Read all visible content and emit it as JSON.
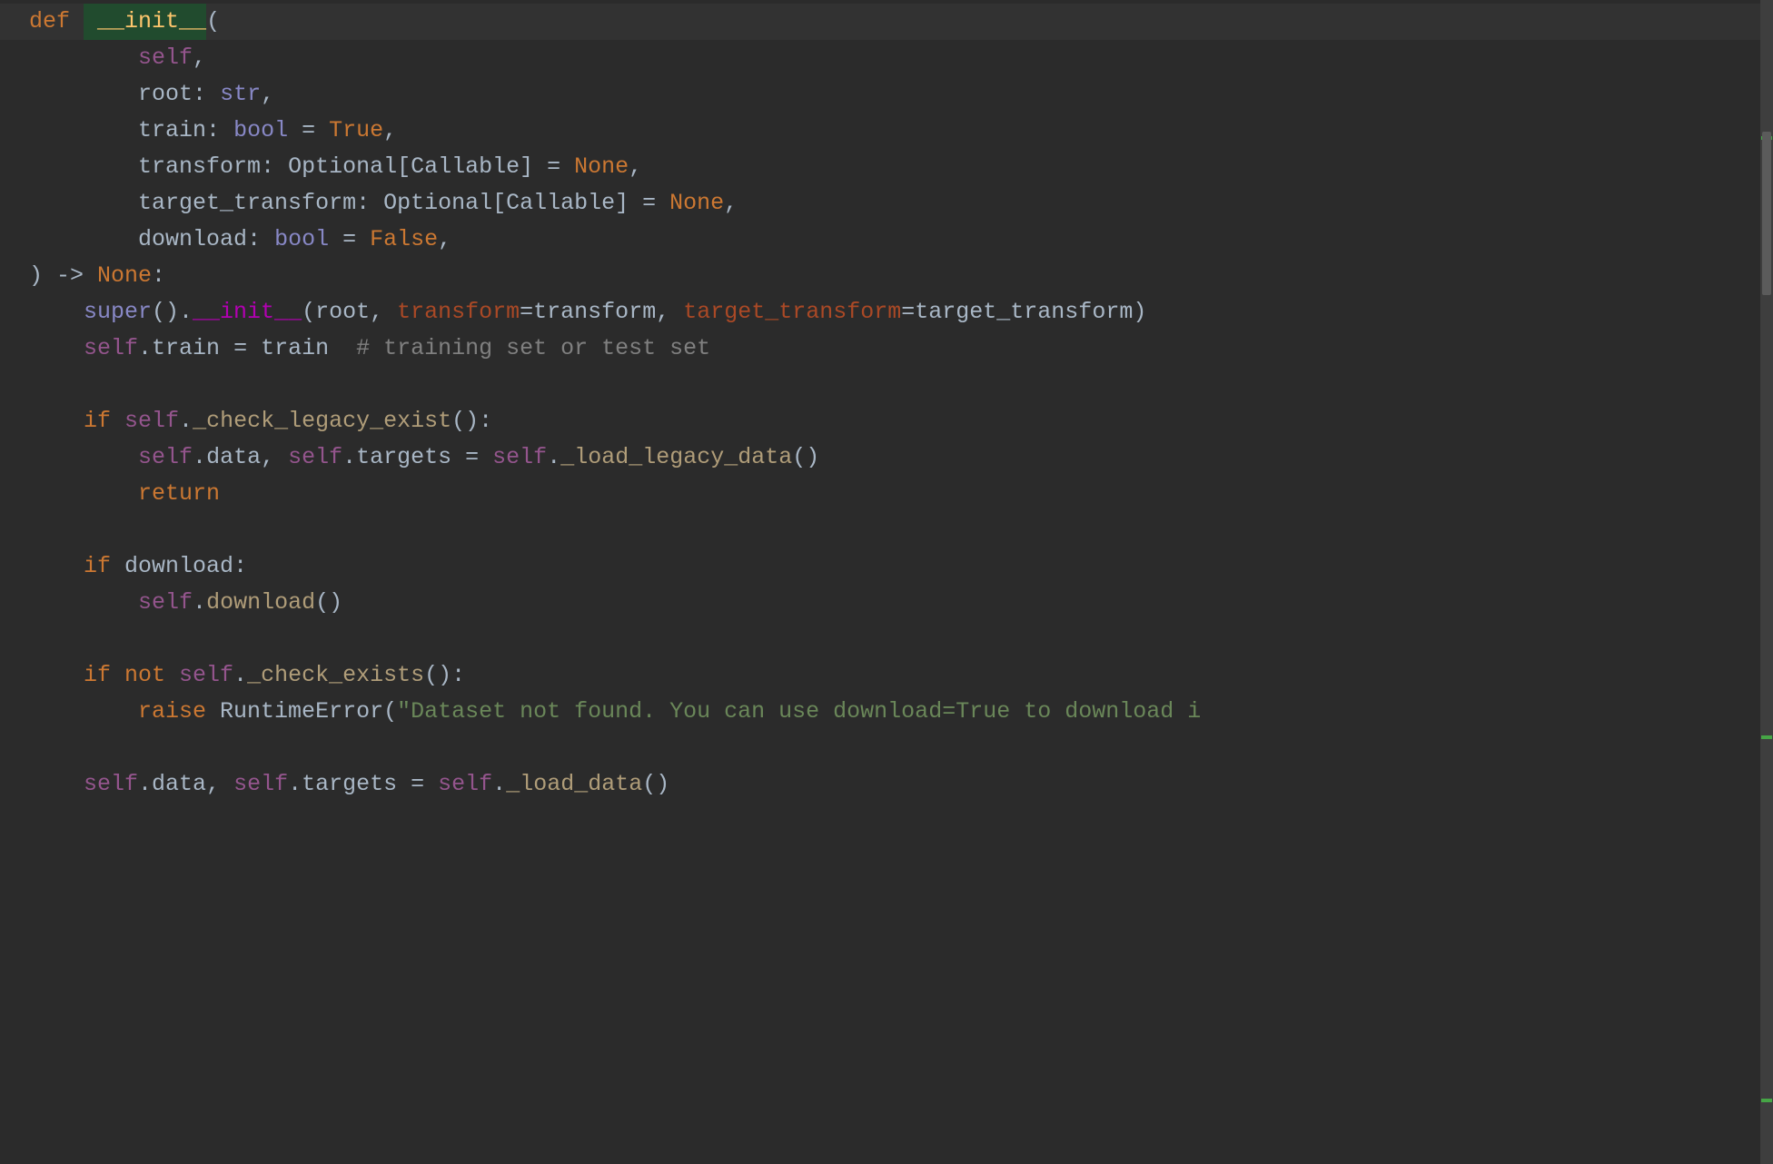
{
  "colors": {
    "bg": "#2b2b2b",
    "current_line": "#323232",
    "keyword": "#cc7832",
    "self": "#94558d",
    "funcname": "#ffc66d",
    "param": "#e3a86c",
    "default": "#a9b7c6",
    "type": "#8888c6",
    "string": "#6a8759",
    "comment": "#808080",
    "kwarg": "#aa4926",
    "dunder": "#b200b2"
  },
  "code": {
    "l01": {
      "kw_def": "def ",
      "caret_sp": " ",
      "fn_name": "__init__",
      "p_open": "("
    },
    "l02": {
      "indent": "        ",
      "self": "self",
      "comma": ","
    },
    "l03": {
      "indent": "        ",
      "p_root": "root",
      "colon_sp": ": ",
      "t_str": "str",
      "comma": ","
    },
    "l04": {
      "indent": "        ",
      "p_train": "train",
      "colon_sp": ": ",
      "t_bool": "bool",
      "eq": " = ",
      "v_true": "True",
      "comma": ","
    },
    "l05": {
      "indent": "        ",
      "p_transform": "transform",
      "colon_sp": ": ",
      "t_optional": "Optional[Callable]",
      "eq": " = ",
      "v_none": "None",
      "comma": ","
    },
    "l06": {
      "indent": "        ",
      "p_target": "target_transform",
      "colon_sp": ": ",
      "t_optional": "Optional[Callable]",
      "eq": " = ",
      "v_none": "None",
      "comma": ","
    },
    "l07": {
      "indent": "        ",
      "p_download": "download",
      "colon_sp": ": ",
      "t_bool": "bool",
      "eq": " = ",
      "v_false": "False",
      "comma": ","
    },
    "l08": {
      "close": ") -> ",
      "none": "None",
      "colon": ":"
    },
    "l09": {
      "indent": "    ",
      "super": "super",
      "call_open": "().",
      "dunder": "__init__",
      "p_open": "(",
      "arg_root": "root",
      "sep": ", ",
      "kw_transform": "transform",
      "eq": "=",
      "val_transform": "transform",
      "sep2": ", ",
      "kw_target": "target_transform",
      "eq2": "=",
      "val_target": "target_transform",
      "p_close": ")"
    },
    "l10": {
      "indent": "    ",
      "self": "self",
      "dot": ".",
      "attr": "train",
      "eq": " = ",
      "val": "train",
      "sp": "  ",
      "comment": "# training set or test set"
    },
    "l11": {
      "blank": ""
    },
    "l12": {
      "indent": "    ",
      "kw_if": "if ",
      "self": "self",
      "dot": ".",
      "method": "_check_legacy_exist",
      "call": "():"
    },
    "l13": {
      "indent": "        ",
      "self": "self",
      "dot": ".",
      "attr_data": "data",
      "sep": ", ",
      "self2": "self",
      "dot2": ".",
      "attr_targets": "targets",
      "eq": " = ",
      "self3": "self",
      "dot3": ".",
      "method": "_load_legacy_data",
      "call": "()"
    },
    "l14": {
      "indent": "        ",
      "kw_return": "return"
    },
    "l15": {
      "blank": ""
    },
    "l16": {
      "indent": "    ",
      "kw_if": "if ",
      "cond": "download",
      "colon": ":"
    },
    "l17": {
      "indent": "        ",
      "self": "self",
      "dot": ".",
      "method": "download",
      "call": "()"
    },
    "l18": {
      "blank": ""
    },
    "l19": {
      "indent": "    ",
      "kw_if": "if ",
      "kw_not": "not ",
      "self": "self",
      "dot": ".",
      "method": "_check_exists",
      "call": "():"
    },
    "l20": {
      "indent": "        ",
      "kw_raise": "raise ",
      "exc": "RuntimeError",
      "p_open": "(",
      "str": "\"Dataset not found. You can use download=True to download i"
    },
    "l21": {
      "blank": ""
    },
    "l22": {
      "indent": "    ",
      "self": "self",
      "dot": ".",
      "attr_data": "data",
      "sep": ", ",
      "self2": "self",
      "dot2": ".",
      "attr_targets": "targets",
      "eq": " = ",
      "self3": "self",
      "dot3": ".",
      "method": "_load_data",
      "call": "()"
    }
  }
}
